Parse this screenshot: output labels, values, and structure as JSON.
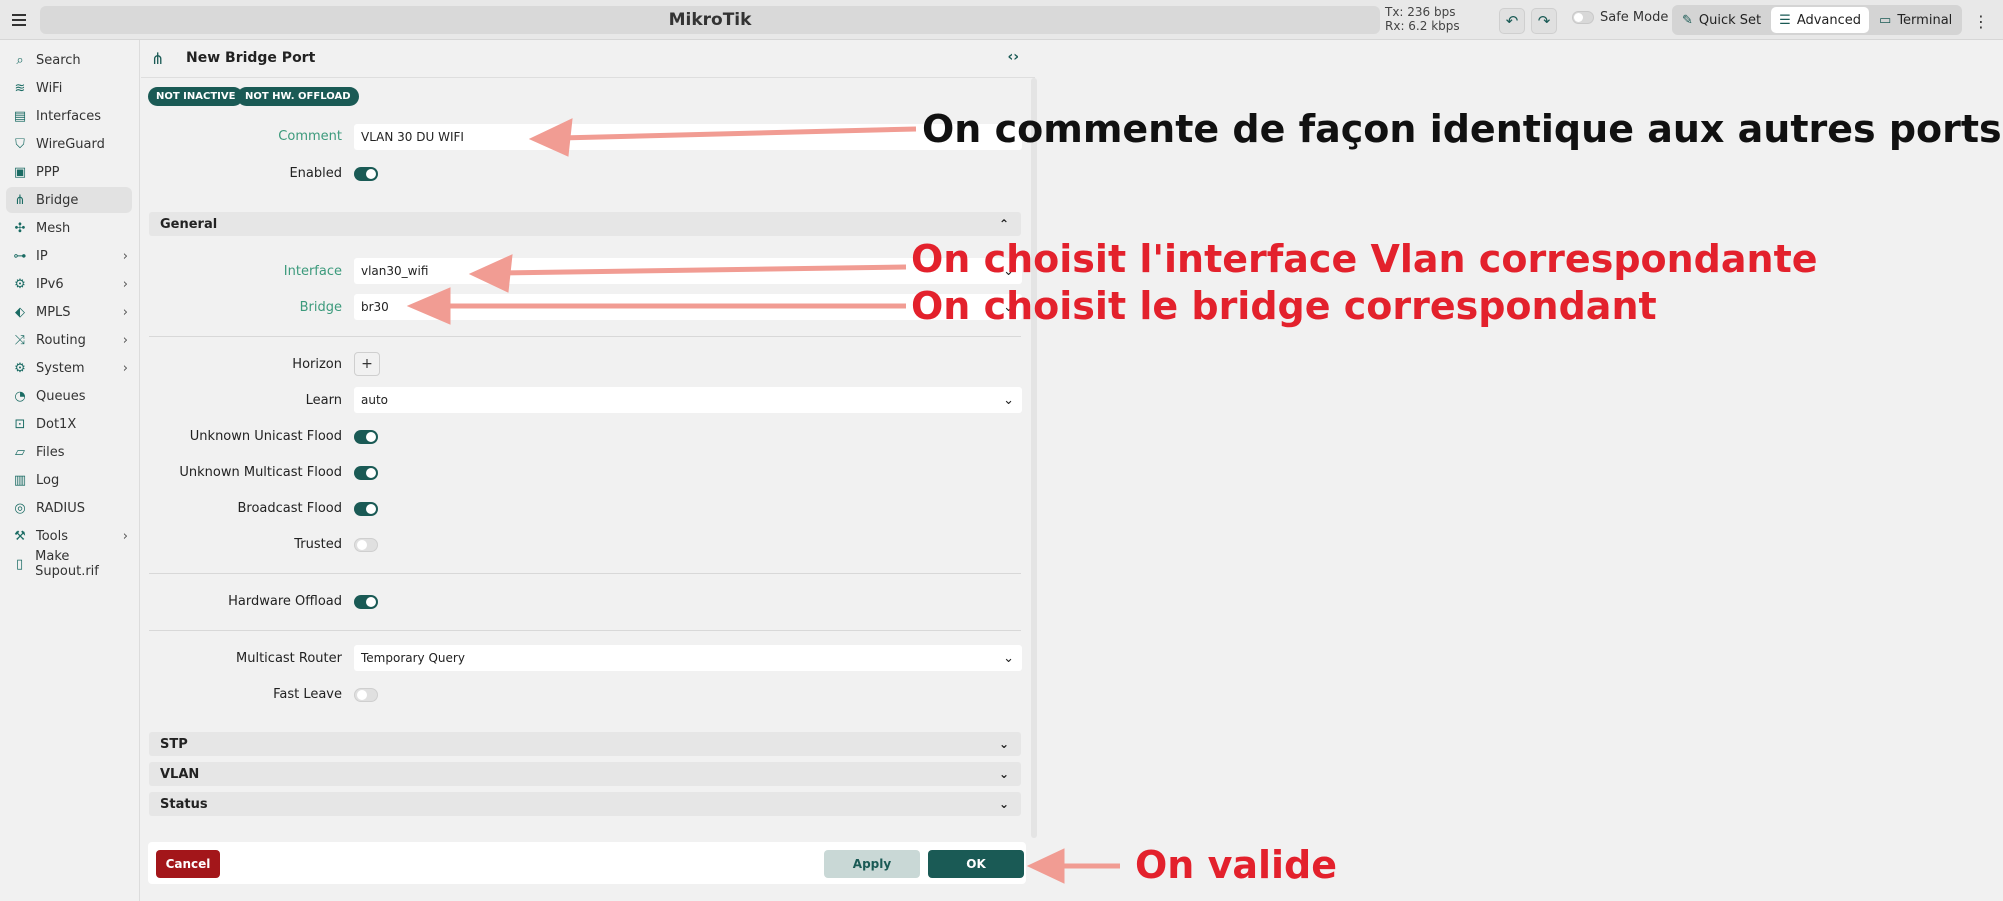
{
  "topbar": {
    "app_title": "MikroTik",
    "tx": "Tx: 236 bps",
    "rx": "Rx: 6.2 kbps",
    "safe_mode": "Safe Mode",
    "modes": [
      "Quick Set",
      "Advanced",
      "Terminal"
    ],
    "active_mode": "Advanced"
  },
  "sidebar": {
    "items": [
      {
        "label": "Search",
        "icon": "search-icon"
      },
      {
        "label": "WiFi",
        "icon": "wifi-icon"
      },
      {
        "label": "Interfaces",
        "icon": "interfaces-icon"
      },
      {
        "label": "WireGuard",
        "icon": "wireguard-icon"
      },
      {
        "label": "PPP",
        "icon": "ppp-icon"
      },
      {
        "label": "Bridge",
        "icon": "bridge-icon"
      },
      {
        "label": "Mesh",
        "icon": "mesh-icon"
      },
      {
        "label": "IP",
        "icon": "ip-icon"
      },
      {
        "label": "IPv6",
        "icon": "ipv6-icon"
      },
      {
        "label": "MPLS",
        "icon": "mpls-icon"
      },
      {
        "label": "Routing",
        "icon": "routing-icon"
      },
      {
        "label": "System",
        "icon": "system-icon"
      },
      {
        "label": "Queues",
        "icon": "queues-icon"
      },
      {
        "label": "Dot1X",
        "icon": "dot1x-icon"
      },
      {
        "label": "Files",
        "icon": "files-icon"
      },
      {
        "label": "Log",
        "icon": "log-icon"
      },
      {
        "label": "RADIUS",
        "icon": "radius-icon"
      },
      {
        "label": "Tools",
        "icon": "tools-icon"
      },
      {
        "label": "Make Supout.rif",
        "icon": "supout-icon"
      }
    ]
  },
  "panel": {
    "title": "New Bridge Port",
    "badges": [
      "NOT INACTIVE",
      "NOT HW. OFFLOAD"
    ],
    "comment_label": "Comment",
    "comment_value": "VLAN 30 DU WIFI",
    "enabled_label": "Enabled",
    "enabled": true,
    "general_section": "General",
    "interface_label": "Interface",
    "interface_value": "vlan30_wifi",
    "bridge_label": "Bridge",
    "bridge_value": "br30",
    "horizon_label": "Horizon",
    "horizon_button": "+",
    "learn_label": "Learn",
    "learn_value": "auto",
    "unknown_unicast_label": "Unknown Unicast Flood",
    "unknown_multicast_label": "Unknown Multicast Flood",
    "broadcast_flood_label": "Broadcast Flood",
    "trusted_label": "Trusted",
    "hardware_offload_label": "Hardware Offload",
    "multicast_router_label": "Multicast Router",
    "multicast_router_value": "Temporary Query",
    "fast_leave_label": "Fast Leave",
    "sections": [
      "STP",
      "VLAN",
      "Status"
    ],
    "cancel": "Cancel",
    "apply": "Apply",
    "ok": "OK"
  },
  "annotations": {
    "comment_note": "On commente de façon identique aux autres ports",
    "interface_note": "On choisit l'interface Vlan correspondante",
    "bridge_note": "On choisit le bridge correspondant",
    "ok_note": "On valide"
  },
  "colors": {
    "accent": "#1a5a55",
    "label_teal": "#3c9a7c",
    "cancel_red": "#a3161a",
    "annotation_red": "#e3212c",
    "arrow": "#f19c93"
  }
}
